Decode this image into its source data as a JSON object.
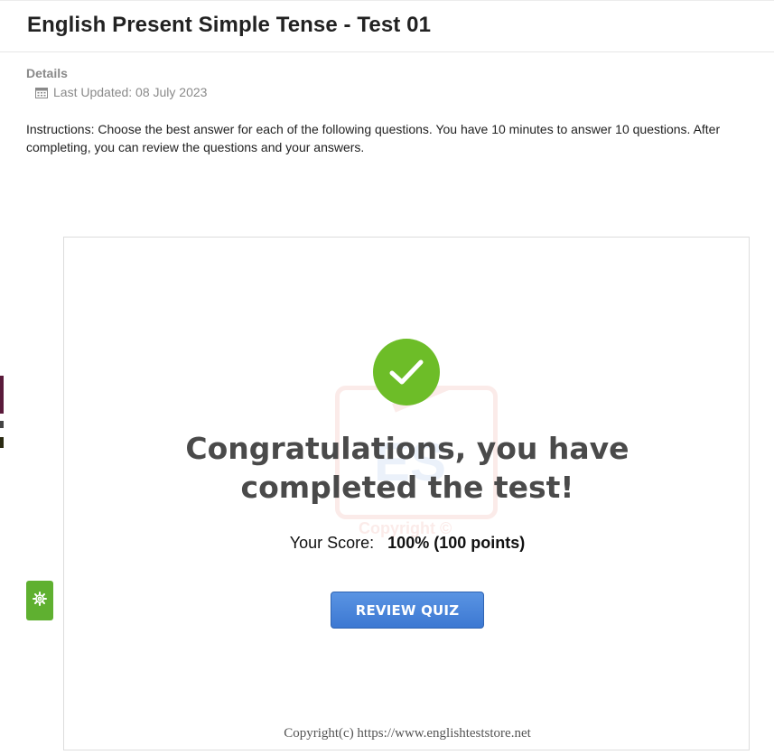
{
  "header": {
    "title": "English Present Simple Tense - Test 01"
  },
  "details": {
    "label": "Details",
    "last_updated": "Last Updated: 08 July 2023"
  },
  "instructions": "Instructions: Choose the best answer for each of the following questions. You have 10 minutes to answer 10 questions. After completing, you can review the questions and your answers.",
  "quiz": {
    "congrats_message": "Congratulations, you have completed the test!",
    "score_label": "Your Score:",
    "score_value": "100% (100 points)",
    "review_button": "REVIEW QUIZ",
    "copyright": "Copyright(c) https://www.englishteststore.net",
    "watermark_text": "Copyright ©"
  },
  "icons": {
    "calendar": "calendar-icon",
    "check": "check-circle-icon",
    "settings": "gear-icon"
  },
  "colors": {
    "success_green": "#6dbd28",
    "settings_green": "#5fb030",
    "button_blue": "#3c78d2"
  }
}
